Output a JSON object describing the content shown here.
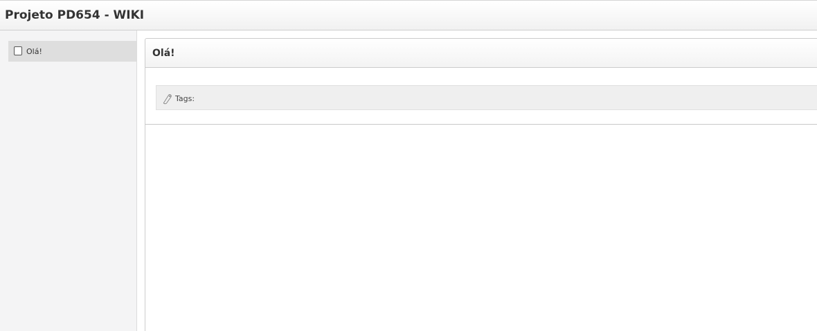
{
  "header": {
    "title": "Projeto PD654 - WIKI"
  },
  "sidebar": {
    "items": [
      {
        "label": "Olá!",
        "icon": "page-icon"
      }
    ]
  },
  "main": {
    "page_title": "Olá!",
    "tags": {
      "label": "Tags:",
      "icon": "tag-icon",
      "values": []
    }
  }
}
